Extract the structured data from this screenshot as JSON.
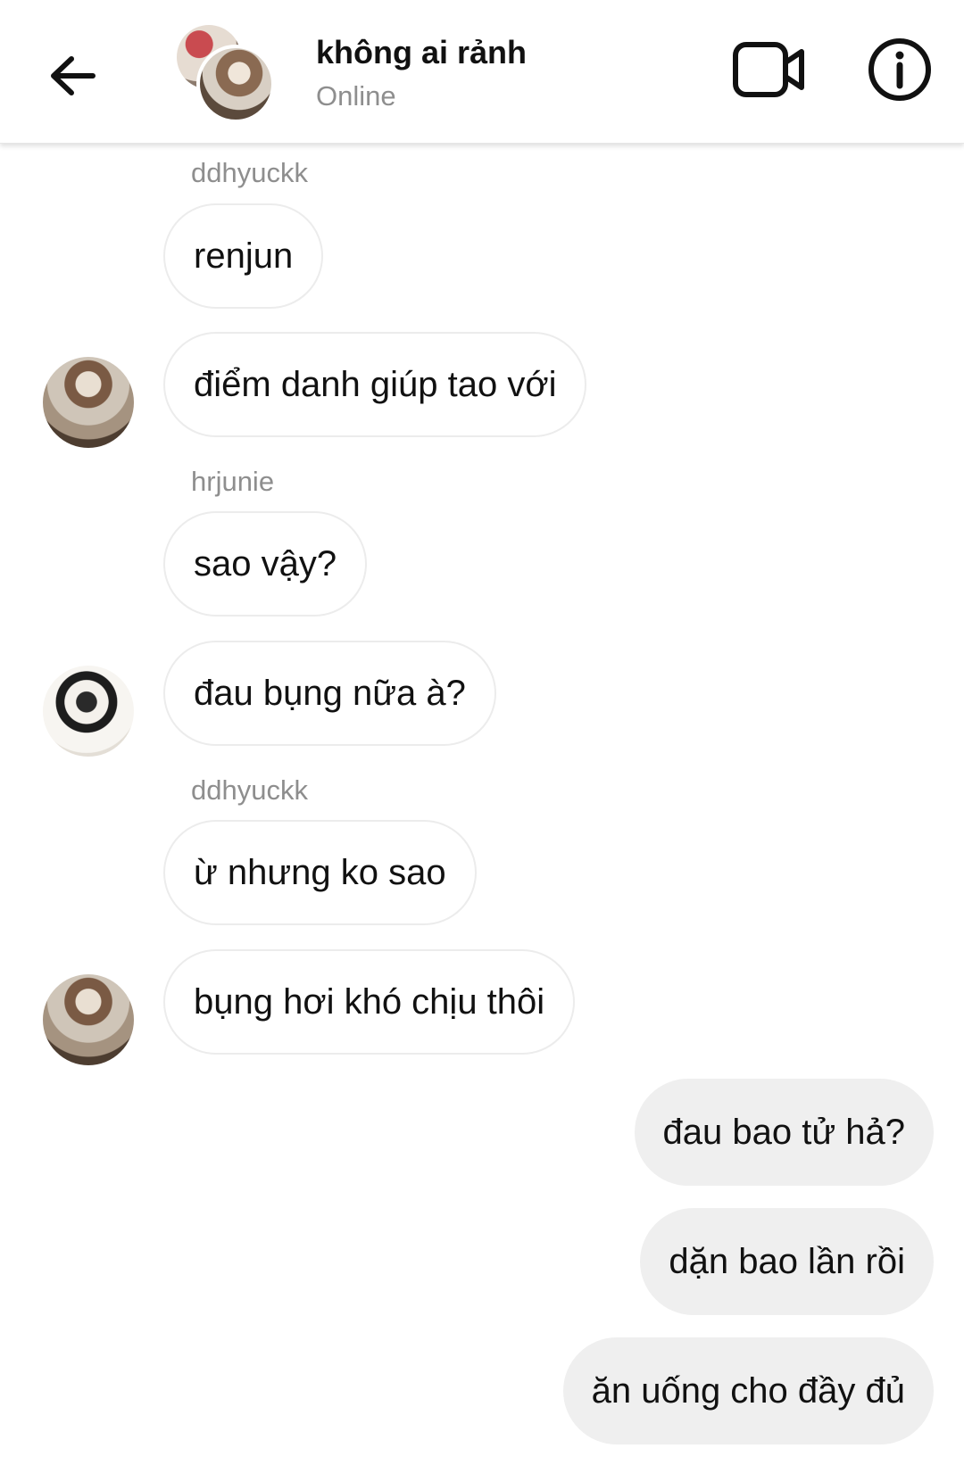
{
  "header": {
    "title": "không ai rảnh",
    "status": "Online",
    "back_icon": "arrow-left-icon",
    "video_icon": "video-camera-icon",
    "info_icon": "info-icon"
  },
  "messages": [
    {
      "sender": "ddhyuckk",
      "text": "renjun"
    },
    {
      "text": "điểm danh giúp tao với"
    },
    {
      "sender": "hrjunie",
      "text": "sao vậy?"
    },
    {
      "text": "đau bụng nữa à?"
    },
    {
      "sender": "ddhyuckk",
      "text": "ừ nhưng ko sao"
    },
    {
      "text": "bụng hơi khó chịu thôi"
    },
    {
      "text": "đau bao tử hả?"
    },
    {
      "text": "dặn bao lần rồi"
    },
    {
      "text": "ăn uống cho đầy đủ"
    }
  ],
  "colors": {
    "outgoing_bubble": "#efefef",
    "incoming_border": "#ececec",
    "muted_text": "#8e8e8e"
  }
}
